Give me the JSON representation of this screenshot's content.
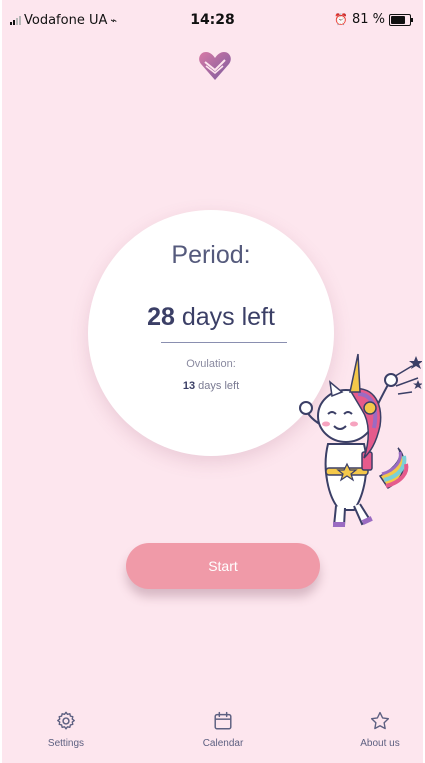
{
  "status_bar": {
    "carrier": "Vodafone UA",
    "time": "14:28",
    "battery": "81 %"
  },
  "cycle": {
    "period_title": "Period:",
    "period_days_number": "28",
    "period_days_suffix": " days left",
    "ovulation_label": "Ovulation:",
    "ovulation_days_number": "13",
    "ovulation_days_suffix": " days left"
  },
  "start_button": {
    "label": "Start"
  },
  "tab_bar": {
    "items": [
      {
        "label": "Settings",
        "icon": "gear-icon"
      },
      {
        "label": "Calendar",
        "icon": "calendar-icon"
      },
      {
        "label": "About us",
        "icon": "star-icon"
      }
    ]
  },
  "colors": {
    "background": "#fde6ee",
    "accent": "#f09aa8",
    "text_dark": "#3b3f66"
  }
}
